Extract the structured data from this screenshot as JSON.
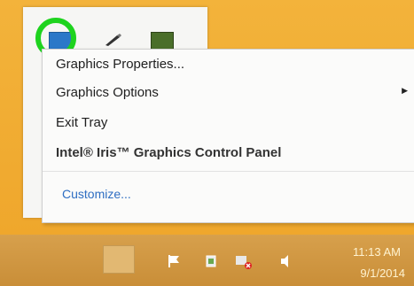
{
  "menu": {
    "items": [
      {
        "label": "Graphics Properties..."
      },
      {
        "label": "Graphics Options"
      },
      {
        "label": "Exit Tray"
      },
      {
        "label": "Intel® Iris™ Graphics Control Panel"
      }
    ]
  },
  "tray": {
    "customize_label": "Customize..."
  },
  "taskbar": {
    "time": "11:13 AM",
    "date": "9/1/2014"
  },
  "colors": {
    "desktop": "#f0a830",
    "highlight_ring": "#1ed31e",
    "link": "#2e6ec2"
  }
}
